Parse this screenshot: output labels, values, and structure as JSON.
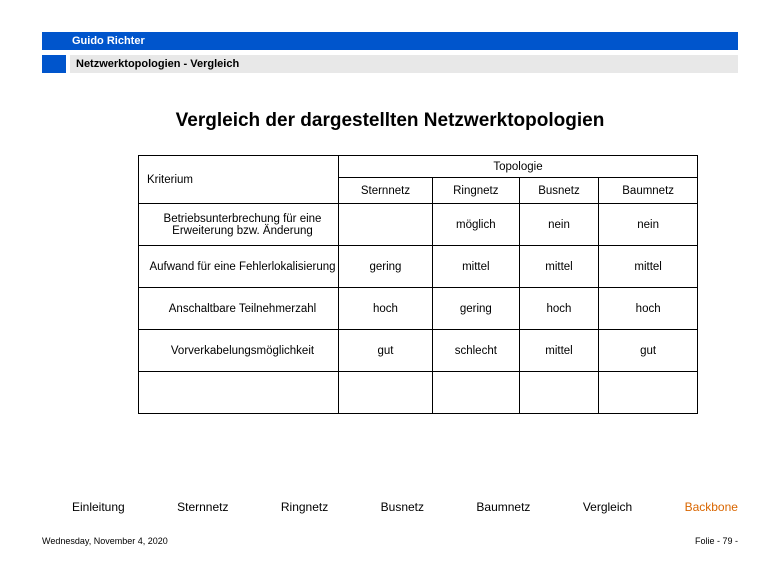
{
  "header": {
    "author": "Guido Richter",
    "breadcrumb": "Netzwerktopologien  - Vergleich"
  },
  "title": "Vergleich der dargestellten Netzwerktopologien",
  "table": {
    "kriterium_label": "Kriterium",
    "topologie_label": "Topologie",
    "columns": [
      "Sternnetz",
      "Ringnetz",
      "Busnetz",
      "Baumnetz"
    ],
    "rows": [
      {
        "label": "Betriebsunterbrechung für eine Erweiterung bzw. Änderung",
        "cells": [
          "",
          "möglich",
          "nein",
          "nein"
        ]
      },
      {
        "label": "Aufwand für eine Fehlerlokalisierung",
        "cells": [
          "gering",
          "mittel",
          "mittel",
          "mittel"
        ]
      },
      {
        "label": "Anschaltbare Teilnehmerzahl",
        "cells": [
          "hoch",
          "gering",
          "hoch",
          "hoch"
        ]
      },
      {
        "label": "Vorverkabelungsmöglichkeit",
        "cells": [
          "gut",
          "schlecht",
          "mittel",
          "gut"
        ]
      }
    ]
  },
  "nav": {
    "items": [
      "Einleitung",
      "Sternnetz",
      "Ringnetz",
      "Busnetz",
      "Baumnetz",
      "Vergleich",
      "Backbone"
    ],
    "active_index": 6
  },
  "footer": {
    "date": "Wednesday, November 4, 2020",
    "page_prefix": "Folie - ",
    "page_number": "79",
    "page_suffix": " -"
  }
}
